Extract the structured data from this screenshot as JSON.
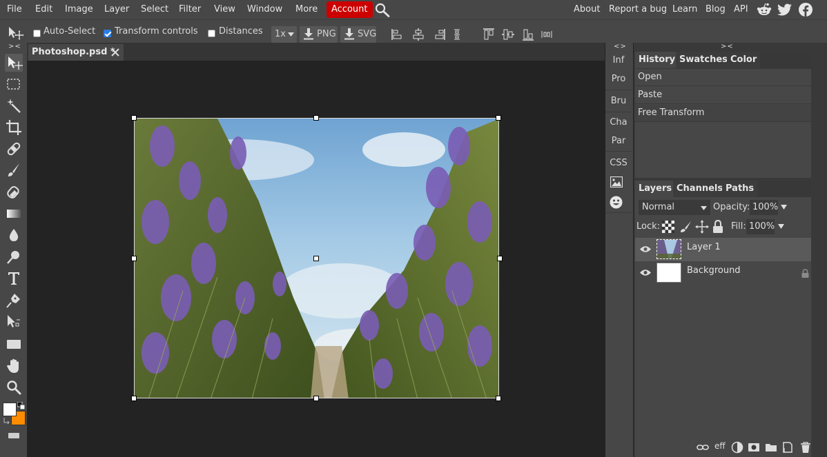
{
  "menu": {
    "items": [
      "File",
      "Edit",
      "Image",
      "Layer",
      "Select",
      "Filter",
      "View",
      "Window",
      "More"
    ],
    "account": "Account",
    "right_links": [
      "About",
      "Report a bug",
      "Learn",
      "Blog",
      "API"
    ],
    "accent_color": "#cc0000"
  },
  "options": {
    "auto_select": "Auto-Select",
    "auto_select_checked": false,
    "transform_controls": "Transform controls",
    "transform_controls_checked": true,
    "distances": "Distances",
    "distances_checked": false,
    "zoom": "1x",
    "png": "PNG",
    "svg": "SVG"
  },
  "tools": [
    "move-tool",
    "marquee-tool",
    "magic-wand-tool",
    "crop-tool",
    "healing-tool",
    "brush-tool",
    "eraser-tool",
    "gradient-tool",
    "blur-tool",
    "dodge-tool",
    "type-tool",
    "pen-tool",
    "path-select-tool",
    "shape-tool",
    "hand-tool",
    "zoom-tool"
  ],
  "document": {
    "tab_title": "Photoshop.psd *"
  },
  "sidepanel": {
    "collapse_label": "<>",
    "tabs": [
      "Inf",
      "Pro",
      "Bru",
      "Cha",
      "Par",
      "CSS"
    ]
  },
  "right": {
    "collapse_label": "><",
    "history_tabs": [
      "History",
      "Swatches",
      "Color"
    ],
    "history_items": [
      "Open",
      "Paste",
      "Free Transform"
    ],
    "layers_tabs": [
      "Layers",
      "Channels",
      "Paths"
    ],
    "blend_mode": "Normal",
    "opacity_label": "Opacity:",
    "opacity": "100%",
    "lock_label": "Lock:",
    "fill_label": "Fill:",
    "fill": "100%",
    "layers": [
      {
        "name": "Layer 1",
        "selected": true
      },
      {
        "name": "Background",
        "selected": false,
        "locked": true
      }
    ],
    "footer_eff": "eff"
  },
  "left": {
    "collapse_label": "><"
  }
}
